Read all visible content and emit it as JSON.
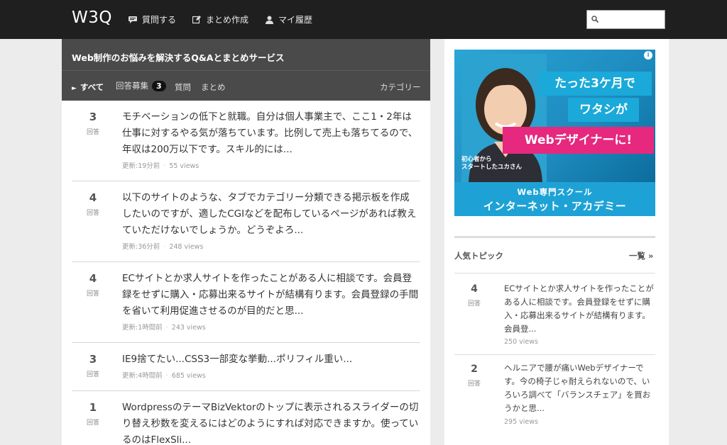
{
  "header": {
    "logo": "W3Q",
    "nav": [
      {
        "label": "質問する",
        "icon": "chat-icon"
      },
      {
        "label": "まとめ作成",
        "icon": "edit-icon"
      },
      {
        "label": "マイ履歴",
        "icon": "user-icon"
      }
    ],
    "search": {
      "placeholder": "",
      "value": ""
    }
  },
  "main": {
    "title": "Web制作のお悩みを解決するQ&Aとまとめサービス",
    "tabs": {
      "all": "すべて",
      "recruiting": "回答募集",
      "recruiting_count": "3",
      "questions": "質問",
      "summaries": "まとめ",
      "category": "カテゴリー"
    },
    "answer_label": "回答",
    "questions": [
      {
        "count": "3",
        "text": "モチベーションの低下と就職。自分は個人事業主で、ここ1・2年は仕事に対するやる気が落ちています。比例して売上も落ちてるので、年収は200万以下です。スキル的には...",
        "updated": "更新:19分前",
        "views": "55 views"
      },
      {
        "count": "4",
        "text": "以下のサイトのような、タブでカテゴリー分類できる掲示板を作成したいのですが、適したCGIなどを配布しているページがあれば教えていただけないでしょうか。どうぞよろ...",
        "updated": "更新:36分前",
        "views": "248 views"
      },
      {
        "count": "4",
        "text": "ECサイトとか求人サイトを作ったことがある人に相談です。会員登録をせずに購入・応募出来るサイトが結構有ります。会員登録の手間を省いて利用促進させるのが目的だと思...",
        "updated": "更新:1時間前",
        "views": "243 views"
      },
      {
        "count": "3",
        "text": "IE9捨てたい...CSS3一部変な挙動...ポリフィル重い...",
        "updated": "更新:4時間前",
        "views": "685 views"
      },
      {
        "count": "1",
        "text": "Wordpressのテーマ​BizVektorのトップに表示されるスライダーの切り替え秒数を変えるにはどのようにすれば対応できますか。使っているのはFlexSli...",
        "updated": "",
        "views": ""
      }
    ]
  },
  "sidebar": {
    "ad": {
      "line1": "たった3ケ月で",
      "line2": "ワタシが",
      "line3": "Webデザイナーに!",
      "caption1": "初心者から",
      "caption2": "スタートしたユカさん",
      "bottom1": "Web専門スクール",
      "bottom2": "インターネット・アカデミー",
      "info": "i"
    },
    "popular_title": "人気トピック",
    "popular_more": "一覧 »",
    "answer_label": "回答",
    "popular": [
      {
        "count": "4",
        "text": "ECサイトとか求人サイトを作ったことがある人に相談です。会員登録をせずに購入・応募出来るサイトが結構有ります。会員登...",
        "views": "250 views"
      },
      {
        "count": "2",
        "text": "ヘルニアで腰が痛いWebデザイナーです。今の椅子じゃ耐えられないので、いろいろ調べて「バランスチェア」を買おうかと思...",
        "views": "295 views"
      }
    ]
  }
}
